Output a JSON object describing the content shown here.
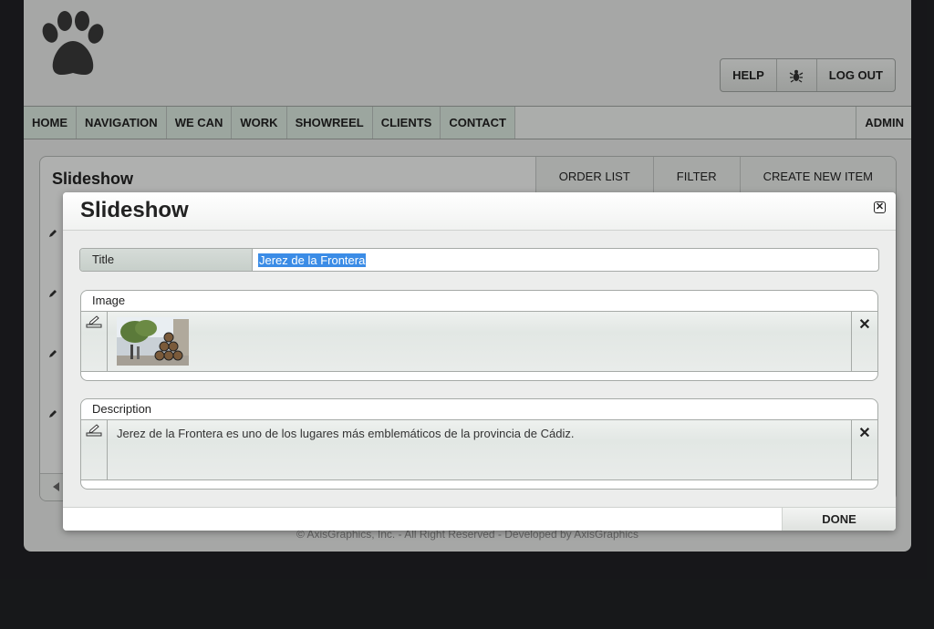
{
  "header": {
    "logo_icon": "paw-print-icon",
    "buttons": [
      {
        "label": "HELP"
      },
      {
        "icon": "bug-icon"
      },
      {
        "label": "LOG OUT"
      }
    ]
  },
  "nav": {
    "items": [
      "HOME",
      "NAVIGATION",
      "WE CAN",
      "WORK",
      "SHOWREEL",
      "CLIENTS",
      "CONTACT"
    ],
    "admin_label": "ADMIN"
  },
  "list": {
    "title": "Slideshow",
    "actions": [
      "ORDER LIST",
      "FILTER",
      "CREATE NEW ITEM"
    ]
  },
  "footer": {
    "text": "© AxisGraphics, Inc. - All Right Reserved - Developed by AxisGraphics"
  },
  "modal": {
    "title": "Slideshow",
    "title_field": {
      "label": "Title",
      "value": "Jerez de la Frontera"
    },
    "image_section": {
      "label": "Image",
      "image_description": "street-with-sherry-barrels"
    },
    "description_section": {
      "label": "Description",
      "text": "Jerez de la Frontera es uno de los lugares más emblemáticos de la provincia de Cádiz."
    },
    "done_label": "DONE"
  },
  "colors": {
    "background": "#202124",
    "nav_active_bg": "#d9e7dd",
    "selection": "#3b8ce6"
  }
}
